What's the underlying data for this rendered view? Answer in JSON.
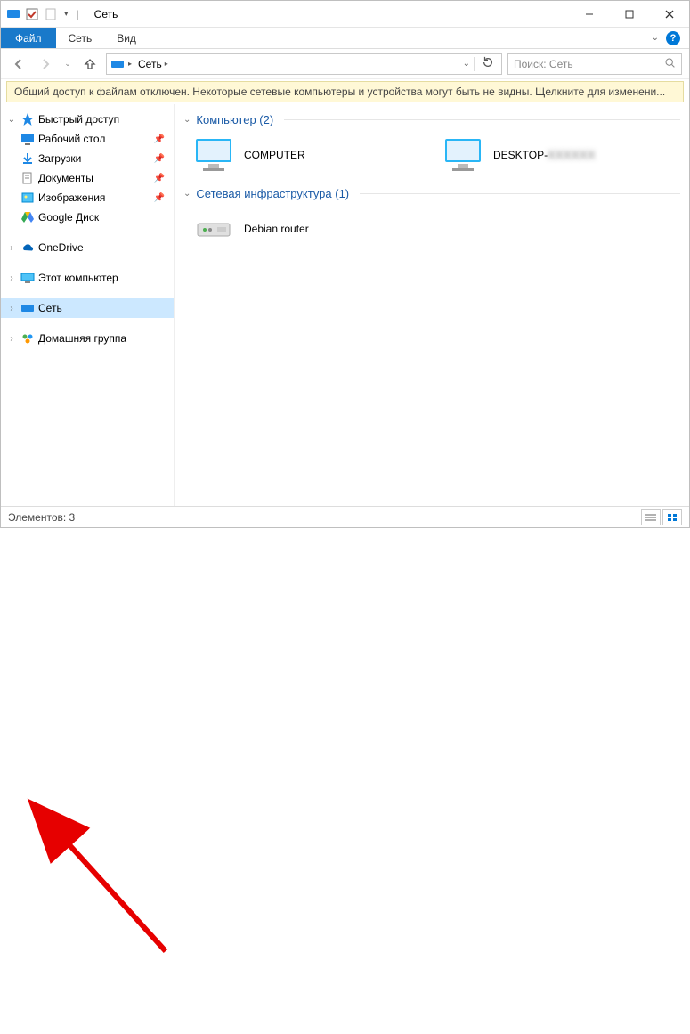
{
  "titlebar": {
    "title": "Сеть"
  },
  "ribbon": {
    "file": "Файл",
    "tabs": [
      "Сеть",
      "Вид"
    ]
  },
  "addressbar": {
    "crumb": "Сеть",
    "search_placeholder": "Поиск: Сеть"
  },
  "infobar": {
    "text": "Общий доступ к файлам отключен. Некоторые сетевые компьютеры и устройства могут быть не видны. Щелкните для изменени..."
  },
  "sidebar": {
    "quick_access": "Быстрый доступ",
    "quick_items": [
      {
        "label": "Рабочий стол",
        "icon": "desktop"
      },
      {
        "label": "Загрузки",
        "icon": "downloads"
      },
      {
        "label": "Документы",
        "icon": "documents"
      },
      {
        "label": "Изображения",
        "icon": "pictures"
      },
      {
        "label": "Google Диск",
        "icon": "gdrive"
      }
    ],
    "onedrive": "OneDrive",
    "this_pc": "Этот компьютер",
    "network": "Сеть",
    "homegroup": "Домашняя группа"
  },
  "content": {
    "group1": {
      "label": "Компьютер",
      "count": 2
    },
    "group1_label": "Компьютер (2)",
    "computers": [
      {
        "label": "COMPUTER"
      },
      {
        "label": "DESKTOP-",
        "obscured": "XXXXXX"
      }
    ],
    "group2_label": "Сетевая инфраструктура (1)",
    "infra": [
      {
        "label": "Debian router"
      }
    ]
  },
  "statusbar": {
    "text": "Элементов: 3"
  }
}
